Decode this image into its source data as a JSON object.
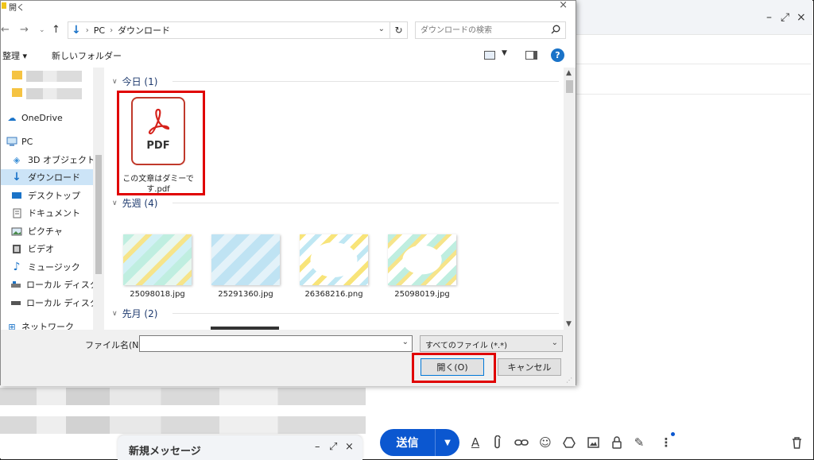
{
  "dialog": {
    "title": "開く",
    "close": "×",
    "breadcrumb": [
      "PC",
      "ダウンロード"
    ],
    "search_placeholder": "ダウンロードの検索",
    "toolbar": {
      "organize": "整理 ▾",
      "new_folder": "新しいフォルダー",
      "help": "?"
    },
    "nav": [
      {
        "label": "OneDrive",
        "icon": "cloud-icon"
      },
      {
        "label": "PC",
        "icon": "pc-icon"
      },
      {
        "label": "3D オブジェクト",
        "icon": "cube-icon"
      },
      {
        "label": "ダウンロード",
        "icon": "download-arrow-icon"
      },
      {
        "label": "デスクトップ",
        "icon": "desktop-icon"
      },
      {
        "label": "ドキュメント",
        "icon": "document-icon"
      },
      {
        "label": "ピクチャ",
        "icon": "picture-icon"
      },
      {
        "label": "ビデオ",
        "icon": "video-icon"
      },
      {
        "label": "ミュージック",
        "icon": "music-icon"
      },
      {
        "label": "ローカル ディスク (C",
        "icon": "drive-icon"
      },
      {
        "label": "ローカル ディスク (C",
        "icon": "drive-icon"
      },
      {
        "label": "ネットワーク",
        "icon": "network-icon"
      }
    ],
    "groups": {
      "today": "今日 (1)",
      "last_week": "先週 (4)",
      "last_month": "先月 (2)"
    },
    "pdf_file": {
      "label": "PDF",
      "name": "この文章はダミーです.pdf"
    },
    "files": [
      {
        "name": "25098018.jpg"
      },
      {
        "name": "25291360.jpg"
      },
      {
        "name": "26368216.png"
      },
      {
        "name": "25098019.jpg"
      }
    ],
    "filename_label": "ファイル名(N):",
    "filename_value": "",
    "filetype": "すべてのファイル (*.*)",
    "open_button": "開く(O)",
    "cancel_button": "キャンセル"
  },
  "compose": {
    "send": "送信",
    "new_message": "新規メッセージ",
    "minimize": "–",
    "expand": "⤢",
    "close": "×"
  },
  "colors": {
    "accent": "#0b57d0",
    "highlight": "#e00000",
    "selected": "#cce4f7"
  }
}
